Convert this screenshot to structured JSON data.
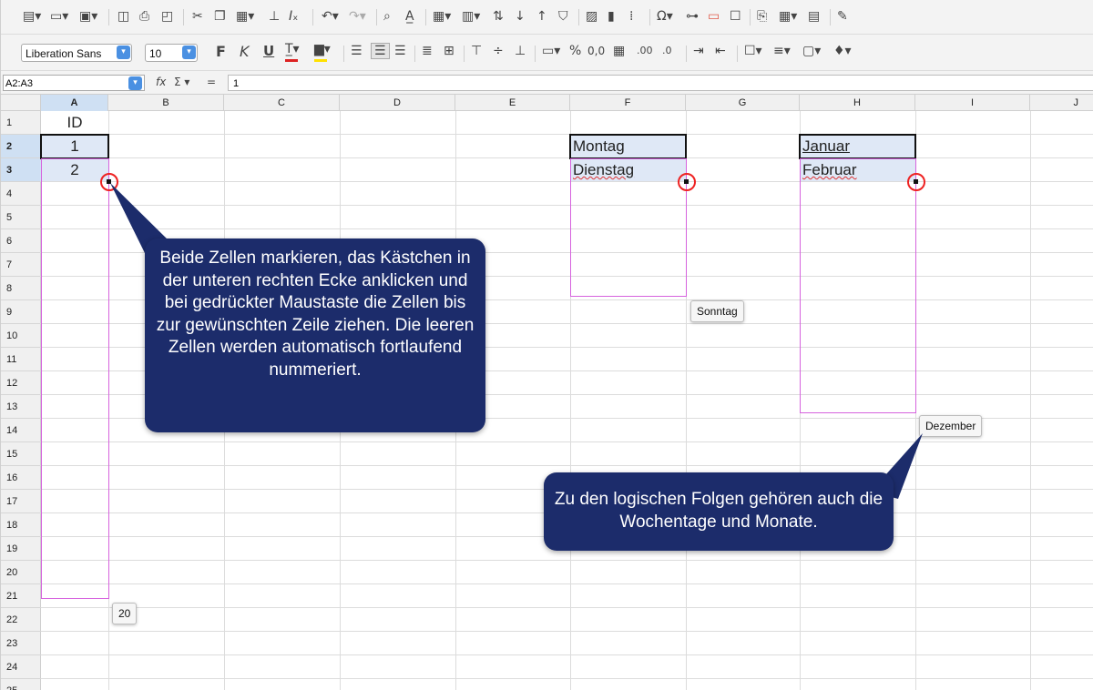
{
  "toolbar": {
    "font_name": "Liberation Sans",
    "font_size": "10",
    "bold_label": "F",
    "italic_label": "K",
    "underline_label": "U",
    "percent_label": "%",
    "decimal_label": "0,0",
    "add_decimal_label": ".00",
    "remove_decimal_label": ".0"
  },
  "formula_bar": {
    "name_box": "A2:A3",
    "fx_label": "fx",
    "sum_label": "Σ ▾",
    "equals_label": "=",
    "content": "1"
  },
  "columns": [
    "A",
    "B",
    "C",
    "D",
    "E",
    "F",
    "G",
    "H",
    "I",
    "J"
  ],
  "rows": [
    "1",
    "2",
    "3",
    "4",
    "5",
    "6",
    "7",
    "8",
    "9",
    "10",
    "11",
    "12",
    "13",
    "14",
    "15",
    "16",
    "17",
    "18",
    "19",
    "20",
    "21",
    "22",
    "23",
    "24",
    "25"
  ],
  "cells": {
    "A1": "ID",
    "A2": "1",
    "A3": "2",
    "F2": "Montag",
    "F3": "Dienstag",
    "H2": "Januar",
    "H3": "Februar"
  },
  "tooltips": {
    "fill_a": "20",
    "fill_f": "Sonntag",
    "fill_h": "Dezember"
  },
  "callouts": {
    "left": "Beide Zellen markieren, das Kästchen in der unteren rechten Ecke anklicken und bei gedrückter Maustaste die Zellen bis zur gewünschten Zeile ziehen. Die leeren Zellen werden automatisch fortlaufend nummeriert.",
    "right": "Zu den logischen Folgen gehören auch die Wochentage und Monate."
  },
  "colors": {
    "callout_bg": "#1c2c6b",
    "fill_outline": "#d663de",
    "handle_circle": "#e22222",
    "selection_fill": "#dfe8f6"
  }
}
